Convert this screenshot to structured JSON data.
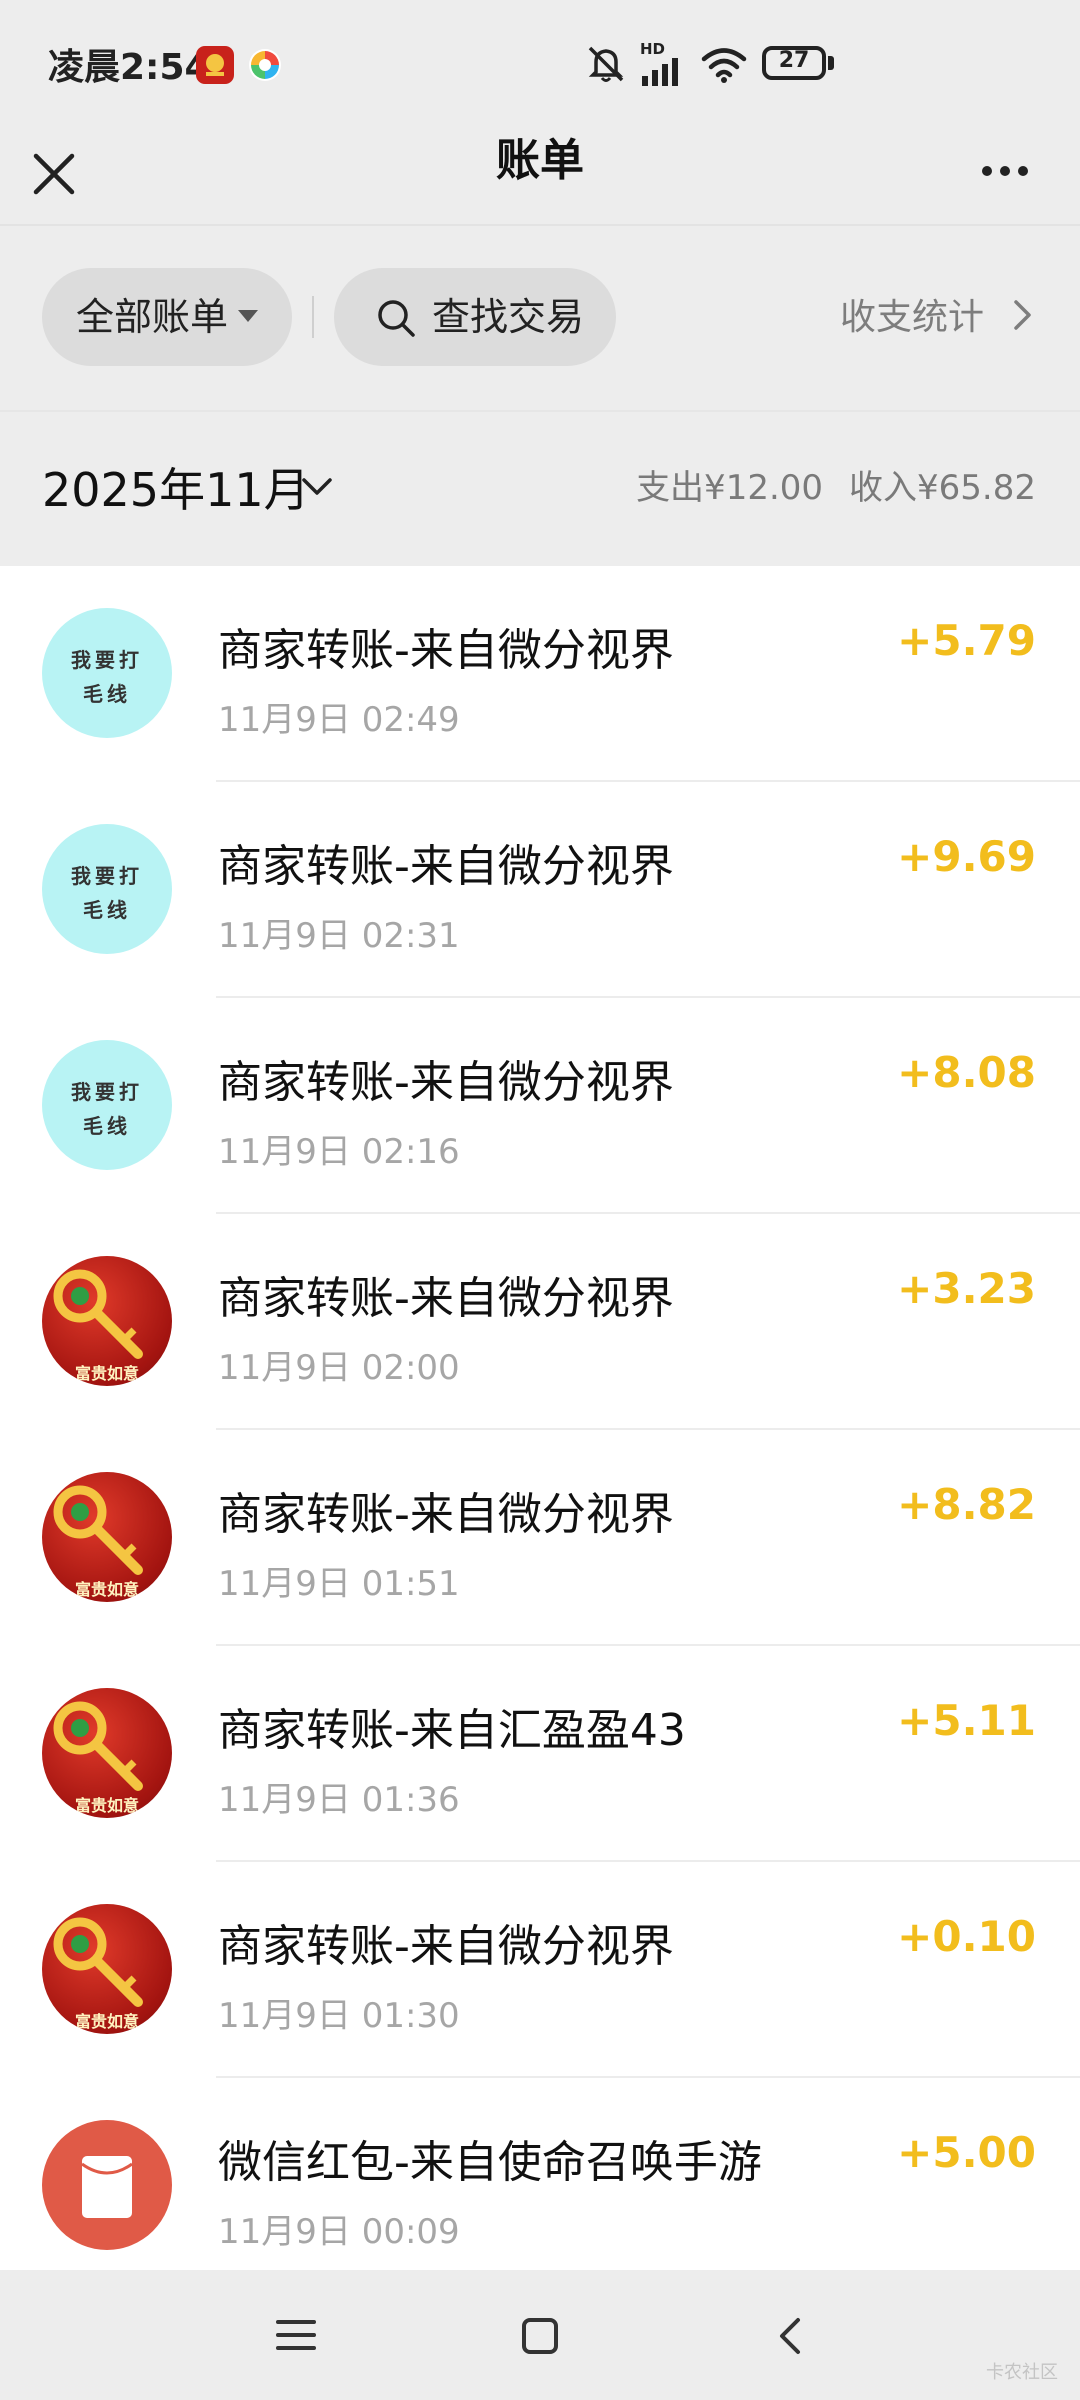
{
  "status_bar": {
    "time": "凌晨2:54",
    "network_badge": "HD",
    "battery": "27",
    "icons": [
      "app-red-icon",
      "app-colorful-icon",
      "mute-icon",
      "signal-icon",
      "wifi-icon",
      "battery-icon"
    ]
  },
  "header": {
    "title": "账单",
    "close_icon": "close-icon",
    "more_icon": "more-icon"
  },
  "filters": {
    "all_bills": "全部账单",
    "search": "查找交易",
    "stats": "收支统计"
  },
  "month": {
    "label": "2025年11月",
    "expense": "支出¥12.00",
    "income": "收入¥65.82"
  },
  "transactions": [
    {
      "title": "商家转账-来自微分视界",
      "time": "11月9日 02:49",
      "amount": "+5.79",
      "avatar": "cyan",
      "avatar_text": [
        "我要打",
        "毛线"
      ]
    },
    {
      "title": "商家转账-来自微分视界",
      "time": "11月9日 02:31",
      "amount": "+9.69",
      "avatar": "cyan",
      "avatar_text": [
        "我要打",
        "毛线"
      ]
    },
    {
      "title": "商家转账-来自微分视界",
      "time": "11月9日 02:16",
      "amount": "+8.08",
      "avatar": "cyan",
      "avatar_text": [
        "我要打",
        "毛线"
      ]
    },
    {
      "title": "商家转账-来自微分视界",
      "time": "11月9日 02:00",
      "amount": "+3.23",
      "avatar": "red",
      "avatar_caption": "富贵如意"
    },
    {
      "title": "商家转账-来自微分视界",
      "time": "11月9日 01:51",
      "amount": "+8.82",
      "avatar": "red",
      "avatar_caption": "富贵如意"
    },
    {
      "title": "商家转账-来自汇盈盈43",
      "time": "11月9日 01:36",
      "amount": "+5.11",
      "avatar": "red",
      "avatar_caption": "富贵如意"
    },
    {
      "title": "商家转账-来自微分视界",
      "time": "11月9日 01:30",
      "amount": "+0.10",
      "avatar": "red",
      "avatar_caption": "富贵如意"
    },
    {
      "title": "微信红包-来自使命召唤手游",
      "time": "11月9日 00:09",
      "amount": "+5.00",
      "avatar": "envelope"
    }
  ],
  "colors": {
    "amount": "#f2bd1d",
    "background": "#ededed",
    "list_bg": "#ffffff",
    "cyan_avatar": "#b8f3f4",
    "envelope": "#e05a47"
  },
  "watermark": "卡农社区"
}
